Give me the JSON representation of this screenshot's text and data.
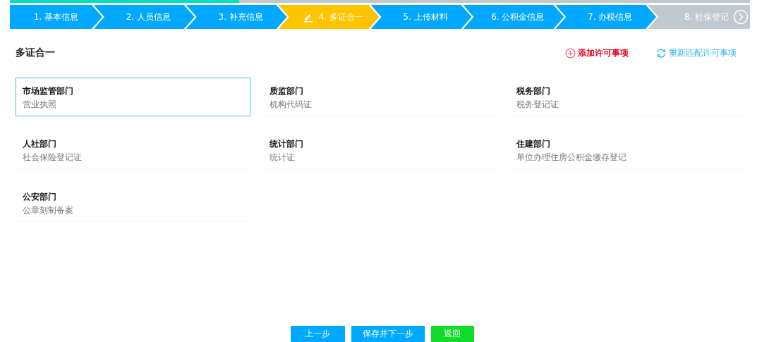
{
  "progress": {
    "level": 0.31
  },
  "steps": [
    {
      "label": "1. 基本信息",
      "selected": false,
      "disabled": false
    },
    {
      "label": "2. 人员信息",
      "selected": false,
      "disabled": false
    },
    {
      "label": "3. 补充信息",
      "selected": false,
      "disabled": false
    },
    {
      "label": "4. 多证合一",
      "selected": true,
      "disabled": false
    },
    {
      "label": "5. 上传材料",
      "selected": false,
      "disabled": false
    },
    {
      "label": "6. 公积金信息",
      "selected": false,
      "disabled": false
    },
    {
      "label": "7. 办税信息",
      "selected": false,
      "disabled": false
    },
    {
      "label": "8. 社保登记",
      "selected": false,
      "disabled": true
    }
  ],
  "section_title": "多证合一",
  "actions": [
    {
      "label": "添加许可事项",
      "kind": "add"
    },
    {
      "label": "重新匹配许可事项",
      "kind": "refresh"
    }
  ],
  "departments": [
    {
      "name": "市场监管部门",
      "license": "营业执照",
      "selected": true
    },
    {
      "name": "质监部门",
      "license": "机构代码证",
      "selected": false
    },
    {
      "name": "税务部门",
      "license": "税务登记证",
      "selected": false
    },
    {
      "name": "人社部门",
      "license": "社会保险登记证",
      "selected": false
    },
    {
      "name": "统计部门",
      "license": "统计证",
      "selected": false
    },
    {
      "name": "住建部门",
      "license": "单位办理住房公积金缴存登记",
      "selected": false
    },
    {
      "name": "公安部门",
      "license": "公章刻制备案",
      "selected": false
    }
  ],
  "buttons": [
    {
      "label": "上一步",
      "kind": "primary"
    },
    {
      "label": "保存并下一步",
      "kind": "primary"
    },
    {
      "label": "返回",
      "kind": "success"
    }
  ]
}
